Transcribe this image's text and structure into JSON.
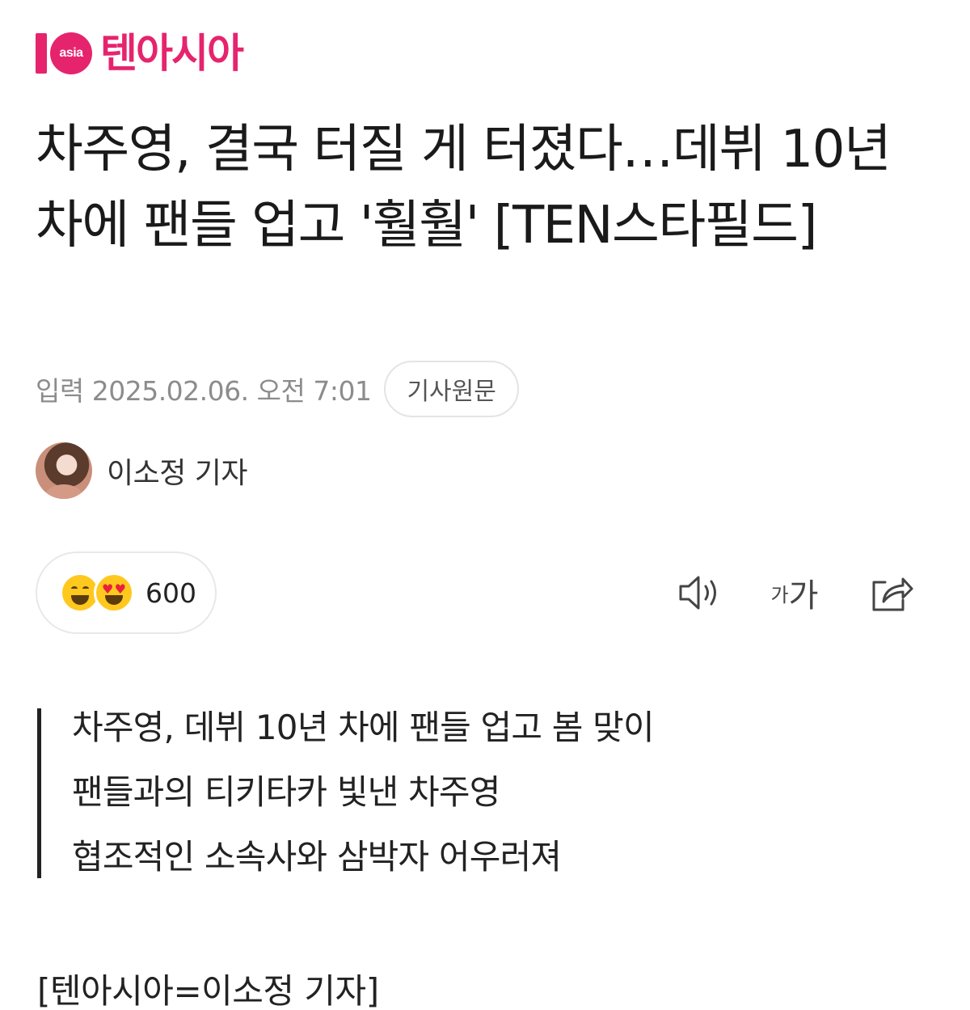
{
  "brand": {
    "logo_mark": "asia",
    "name": "텐아시아",
    "color": "#e6246e"
  },
  "article": {
    "headline": "차주영, 결국 터질 게 터졌다…데뷔 10년 차에 팬들 업고 '훨훨' [TEN스타필드]",
    "date": "입력 2025.02.06. 오전 7:01",
    "source_button": "기사원문",
    "reporter": "이소정 기자",
    "reaction_count": "600",
    "summary": [
      "차주영, 데뷔 10년 차에 팬들 업고 봄 맞이",
      "팬들과의 티키타카 빛낸 차주영",
      "협조적인 소속사와 삼박자 어우러져"
    ],
    "body_first_line": "[텐아시아=이소정 기자]"
  },
  "toolbar": {
    "font_small": "가",
    "font_large": "가",
    "icons": [
      "speaker-icon",
      "font-size-icon",
      "share-icon"
    ]
  },
  "emojis": [
    "laughing-emoji",
    "heart-eyes-emoji"
  ]
}
